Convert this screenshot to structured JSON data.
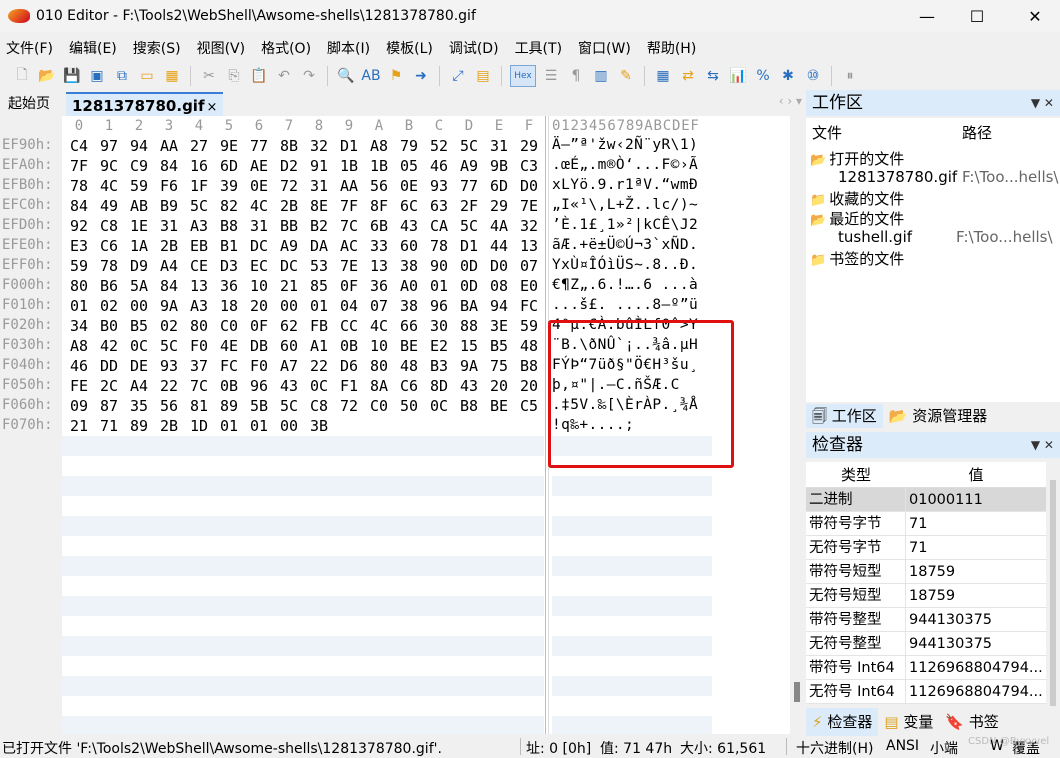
{
  "window": {
    "app_name": "010 Editor",
    "title": "010 Editor - F:\\Tools2\\WebShell\\Awsome-shells\\1281378780.gif",
    "min_glyph": "—",
    "max_glyph": "☐",
    "close_glyph": "✕"
  },
  "menu": [
    "文件(F)",
    "编辑(E)",
    "搜索(S)",
    "视图(V)",
    "格式(O)",
    "脚本(I)",
    "模板(L)",
    "调试(D)",
    "工具(T)",
    "窗口(W)",
    "帮助(H)"
  ],
  "toolbar": {
    "hex_label": "Hex"
  },
  "tabs": {
    "start": "起始页",
    "file": "1281378780.gif",
    "close": "×",
    "nav": "‹ ›  ▾"
  },
  "hex": {
    "column_headers": [
      "0",
      "1",
      "2",
      "3",
      "4",
      "5",
      "6",
      "7",
      "8",
      "9",
      "A",
      "B",
      "C",
      "D",
      "E",
      "F"
    ],
    "ascii_header": "0123456789ABCDEF",
    "rows": [
      {
        "addr": "EF90h:",
        "bytes": [
          "C4",
          "97",
          "94",
          "AA",
          "27",
          "9E",
          "77",
          "8B",
          "32",
          "D1",
          "A8",
          "79",
          "52",
          "5C",
          "31",
          "29"
        ],
        "ascii": "Ä—”ª'žw‹2Ñ¨yR\\1)"
      },
      {
        "addr": "EFA0h:",
        "bytes": [
          "7F",
          "9C",
          "C9",
          "84",
          "16",
          "6D",
          "AE",
          "D2",
          "91",
          "1B",
          "1B",
          "05",
          "46",
          "A9",
          "9B",
          "C3"
        ],
        "ascii": ".œÉ„.m®Ò‘...F©›Ã"
      },
      {
        "addr": "EFB0h:",
        "bytes": [
          "78",
          "4C",
          "59",
          "F6",
          "1F",
          "39",
          "0E",
          "72",
          "31",
          "AA",
          "56",
          "0E",
          "93",
          "77",
          "6D",
          "D0"
        ],
        "ascii": "xLYö.9.r1ªV.“wmÐ"
      },
      {
        "addr": "EFC0h:",
        "bytes": [
          "84",
          "49",
          "AB",
          "B9",
          "5C",
          "82",
          "4C",
          "2B",
          "8E",
          "7F",
          "8F",
          "6C",
          "63",
          "2F",
          "29",
          "7E"
        ],
        "ascii": "„I«¹\\‚L+Ž..lc/)~"
      },
      {
        "addr": "EFD0h:",
        "bytes": [
          "92",
          "C8",
          "1E",
          "31",
          "A3",
          "B8",
          "31",
          "BB",
          "B2",
          "7C",
          "6B",
          "43",
          "CA",
          "5C",
          "4A",
          "32"
        ],
        "ascii": "’È.1£¸1»²|kCÊ\\J2"
      },
      {
        "addr": "EFE0h:",
        "bytes": [
          "E3",
          "C6",
          "1A",
          "2B",
          "EB",
          "B1",
          "DC",
          "A9",
          "DA",
          "AC",
          "33",
          "60",
          "78",
          "D1",
          "44",
          "13"
        ],
        "ascii": "ãÆ.+ë±Ü©Ú¬3`xÑD."
      },
      {
        "addr": "EFF0h:",
        "bytes": [
          "59",
          "78",
          "D9",
          "A4",
          "CE",
          "D3",
          "EC",
          "DC",
          "53",
          "7E",
          "13",
          "38",
          "90",
          "0D",
          "D0",
          "07"
        ],
        "ascii": "YxÙ¤ÎÓìÜS~.8..Ð."
      },
      {
        "addr": "F000h:",
        "bytes": [
          "80",
          "B6",
          "5A",
          "84",
          "13",
          "36",
          "10",
          "21",
          "85",
          "0F",
          "36",
          "A0",
          "01",
          "0D",
          "08",
          "E0"
        ],
        "ascii": "€¶Z„.6.!….6 ...à"
      },
      {
        "addr": "F010h:",
        "bytes": [
          "01",
          "02",
          "00",
          "9A",
          "A3",
          "18",
          "20",
          "00",
          "01",
          "04",
          "07",
          "38",
          "96",
          "BA",
          "94",
          "FC"
        ],
        "ascii": "...š£. ....8–º”ü"
      },
      {
        "addr": "F020h:",
        "bytes": [
          "34",
          "B0",
          "B5",
          "02",
          "80",
          "C0",
          "0F",
          "62",
          "FB",
          "CC",
          "4C",
          "66",
          "30",
          "88",
          "3E",
          "59"
        ],
        "ascii": "4°µ.€À.bûÌLf0ˆ>Y"
      },
      {
        "addr": "F030h:",
        "bytes": [
          "A8",
          "42",
          "0C",
          "5C",
          "F0",
          "4E",
          "DB",
          "60",
          "A1",
          "0B",
          "10",
          "BE",
          "E2",
          "15",
          "B5",
          "48"
        ],
        "ascii": "¨B.\\ðNÛ`¡..¾â.µH"
      },
      {
        "addr": "F040h:",
        "bytes": [
          "46",
          "DD",
          "DE",
          "93",
          "37",
          "FC",
          "F0",
          "A7",
          "22",
          "D6",
          "80",
          "48",
          "B3",
          "9A",
          "75",
          "B8"
        ],
        "ascii": "FÝÞ“7üð§\"Ö€H³šu¸"
      },
      {
        "addr": "F050h:",
        "bytes": [
          "FE",
          "2C",
          "A4",
          "22",
          "7C",
          "0B",
          "96",
          "43",
          "0C",
          "F1",
          "8A",
          "C6",
          "8D",
          "43",
          "20",
          "20"
        ],
        "ascii": "þ,¤\"|.–C.ñŠÆ.C  "
      },
      {
        "addr": "F060h:",
        "bytes": [
          "09",
          "87",
          "35",
          "56",
          "81",
          "89",
          "5B",
          "5C",
          "C8",
          "72",
          "C0",
          "50",
          "0C",
          "B8",
          "BE",
          "C5"
        ],
        "ascii": ".‡5V.‰[\\ÈrÀP.¸¾Å"
      },
      {
        "addr": "F070h:",
        "bytes": [
          "21",
          "71",
          "89",
          "2B",
          "1D",
          "01",
          "01",
          "00",
          "3B"
        ],
        "ascii": "!q‰+....;"
      }
    ]
  },
  "workspace": {
    "title": "工作区",
    "col_file": "文件",
    "col_path": "路径",
    "open_files_label": "打开的文件",
    "open_file_name": "1281378780.gif",
    "open_file_path": "F:\\Too...hells\\",
    "favorites_label": "收藏的文件",
    "recent_label": "最近的文件",
    "recent_file_name": "tushell.gif",
    "recent_file_path": "F:\\Too...hells\\",
    "bookmarks_label": "书签的文件",
    "tab_workspace": "工作区",
    "tab_explorer": "资源管理器"
  },
  "inspector": {
    "title": "检查器",
    "col_type": "类型",
    "col_value": "值",
    "rows": [
      {
        "type": "二进制",
        "value": "01000111",
        "selected": true
      },
      {
        "type": "带符号字节",
        "value": "71"
      },
      {
        "type": "无符号字节",
        "value": "71"
      },
      {
        "type": "带符号短型",
        "value": "18759"
      },
      {
        "type": "无符号短型",
        "value": "18759"
      },
      {
        "type": "带符号整型",
        "value": "944130375"
      },
      {
        "type": "无符号整型",
        "value": "944130375"
      },
      {
        "type": "带符号 Int64",
        "value": "1126968804794..."
      },
      {
        "type": "无符号 Int64",
        "value": "1126968804794..."
      }
    ],
    "tab_inspector": "检查器",
    "tab_variables": "变量",
    "tab_bookmarks": "书签"
  },
  "status": {
    "message": "已打开文件 'F:\\Tools2\\WebShell\\Awsome-shells\\1281378780.gif'.",
    "address": "址: 0 [0h]",
    "value": "值: 71 47h",
    "size": "大小: 61,561",
    "mode": "十六进制(H)",
    "encoding": "ANSI",
    "endian": "小端",
    "write": "W",
    "overwrite": "覆盖"
  },
  "watermark": "CSDN @Byxyvel"
}
